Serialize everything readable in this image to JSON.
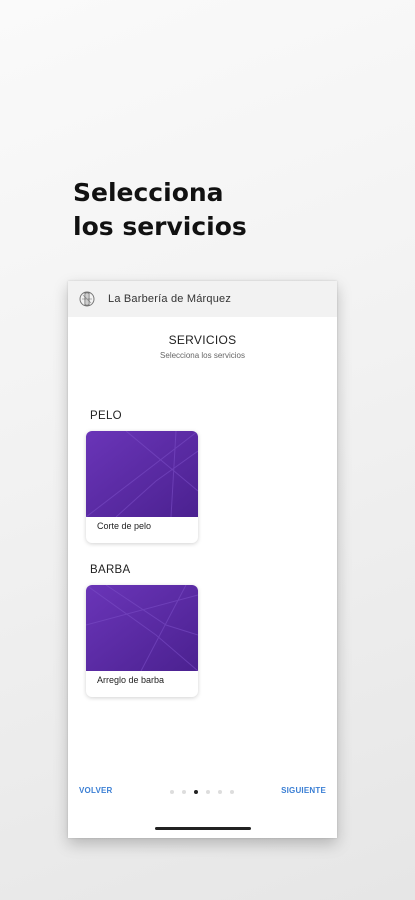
{
  "headline": {
    "line1": "Selecciona",
    "line2": "los servicios"
  },
  "app": {
    "title": "La Barbería de Márquez",
    "logo_icon": "barber-logo-icon"
  },
  "screen": {
    "title": "SERVICIOS",
    "subtitle": "Selecciona los servicios"
  },
  "sections": [
    {
      "label": "PELO",
      "items": [
        {
          "label": "Corte de pelo"
        }
      ]
    },
    {
      "label": "BARBA",
      "items": [
        {
          "label": "Arreglo de barba"
        }
      ]
    }
  ],
  "footer": {
    "back_label": "VOLVER",
    "next_label": "SIGUIENTE",
    "steps_total": 6,
    "current_step": 3
  },
  "colors": {
    "accent": "#3b7fd4",
    "card_purple": "#5a2ca6"
  }
}
